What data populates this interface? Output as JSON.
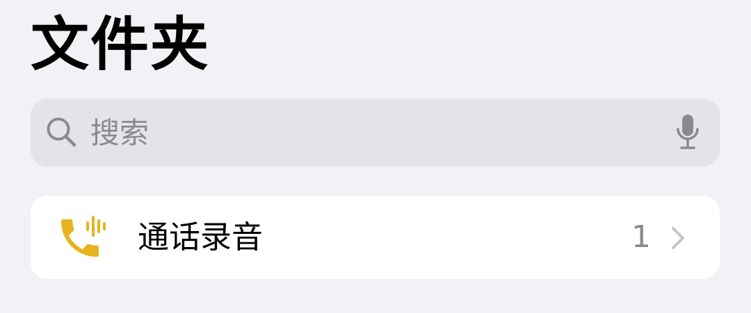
{
  "header": {
    "title": "文件夹"
  },
  "search": {
    "placeholder": "搜索",
    "icon": "search-icon",
    "mic_icon": "microphone-icon"
  },
  "folders": [
    {
      "label": "通话录音",
      "count": "1",
      "icon": "phone-waveform-icon",
      "chevron_icon": "chevron-right-icon"
    }
  ],
  "colors": {
    "background": "#f2f1f6",
    "search_background": "#e4e3e9",
    "card_background": "#ffffff",
    "text": "#000000",
    "muted": "#8a8a8e",
    "accent": "#e6b31e",
    "chevron": "#c4c4c8"
  }
}
